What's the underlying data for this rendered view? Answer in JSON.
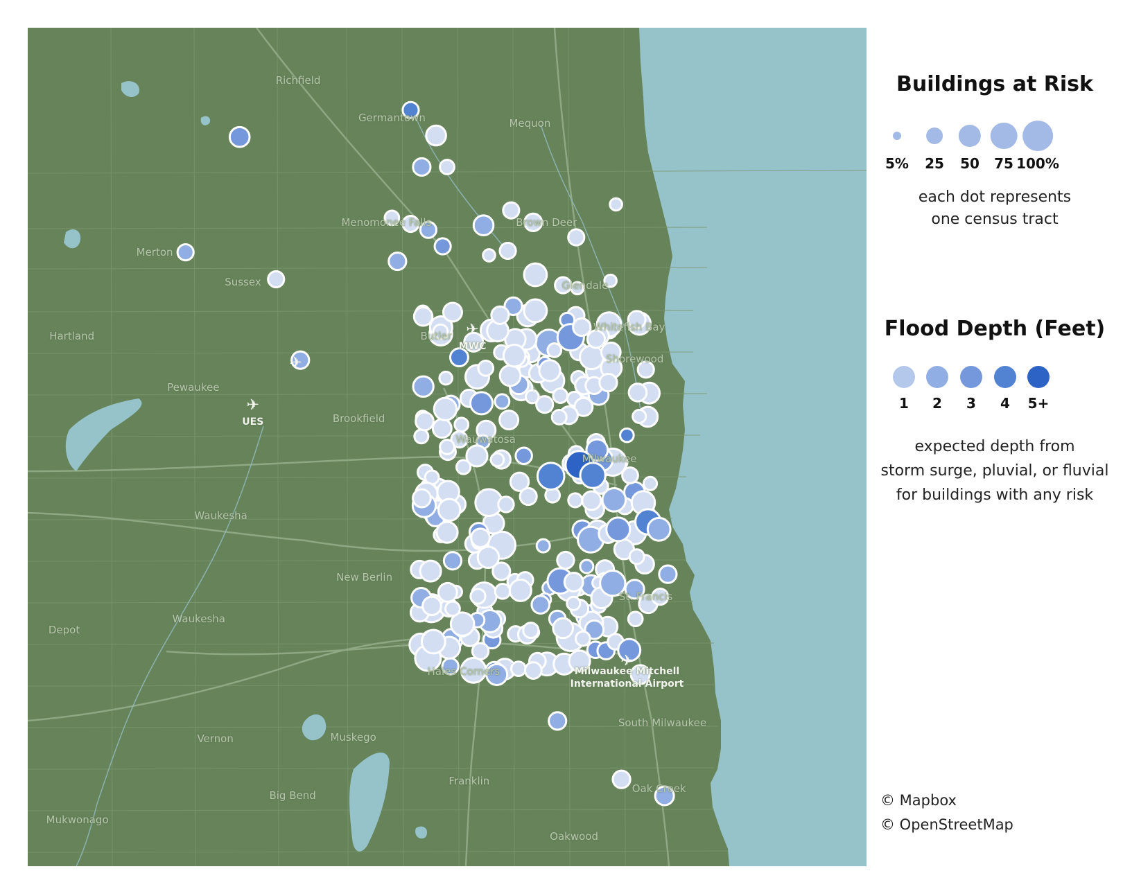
{
  "map": {
    "places": [
      {
        "name": "Richfield",
        "lat": 43.255,
        "lon": -88.195
      },
      {
        "name": "Germantown",
        "lat": 43.23,
        "lon": -88.11
      },
      {
        "name": "Mequon",
        "lat": 43.226,
        "lon": -87.985
      },
      {
        "name": "Menomonee Falls",
        "lat": 43.16,
        "lon": -88.115
      },
      {
        "name": "Brown Deer",
        "lat": 43.16,
        "lon": -87.97
      },
      {
        "name": "Merton",
        "lat": 43.14,
        "lon": -88.325
      },
      {
        "name": "Sussex",
        "lat": 43.12,
        "lon": -88.245
      },
      {
        "name": "Glendale",
        "lat": 43.118,
        "lon": -87.935
      },
      {
        "name": "Whitefish Bay",
        "lat": 43.09,
        "lon": -87.895
      },
      {
        "name": "Butler",
        "lat": 43.084,
        "lon": -88.07
      },
      {
        "name": "Hartland",
        "lat": 43.084,
        "lon": -88.4
      },
      {
        "name": "Shorewood",
        "lat": 43.069,
        "lon": -87.89
      },
      {
        "name": "Pewaukee",
        "lat": 43.05,
        "lon": -88.29
      },
      {
        "name": "Brookfield",
        "lat": 43.029,
        "lon": -88.14
      },
      {
        "name": "Wauwatosa",
        "lat": 43.015,
        "lon": -88.025
      },
      {
        "name": "Milwaukee",
        "lat": 43.002,
        "lon": -87.913
      },
      {
        "name": "Waukesha",
        "lat": 42.964,
        "lon": -88.265
      },
      {
        "name": "New Berlin",
        "lat": 42.923,
        "lon": -88.135
      },
      {
        "name": "St. Francis",
        "lat": 42.91,
        "lon": -87.88
      },
      {
        "name": "Waukesha",
        "lat": 42.895,
        "lon": -88.285
      },
      {
        "name": "Depot",
        "lat": 42.888,
        "lon": -88.407
      },
      {
        "name": "Hales Corners",
        "lat": 42.86,
        "lon": -88.045
      },
      {
        "name": "South Milwaukee",
        "lat": 42.826,
        "lon": -87.865
      },
      {
        "name": "Muskego",
        "lat": 42.816,
        "lon": -88.145
      },
      {
        "name": "Vernon",
        "lat": 42.815,
        "lon": -88.27
      },
      {
        "name": "Franklin",
        "lat": 42.787,
        "lon": -88.04
      },
      {
        "name": "Oak Creek",
        "lat": 42.782,
        "lon": -87.868
      },
      {
        "name": "Big Bend",
        "lat": 42.777,
        "lon": -88.2
      },
      {
        "name": "Mukwonago",
        "lat": 42.761,
        "lon": -88.395
      },
      {
        "name": "Oakwood",
        "lat": 42.75,
        "lon": -87.945
      }
    ],
    "airports": [
      {
        "name": "MWC",
        "lat": 43.088,
        "lon": -88.037
      },
      {
        "name": "UES",
        "lat": 43.038,
        "lon": -88.236
      },
      {
        "name": "Milwaukee Mitchell International Airport",
        "lat": 42.867,
        "lon": -87.897
      },
      {
        "name": "",
        "lat": 43.066,
        "lon": -88.197
      }
    ]
  },
  "legend": {
    "size_title": "Buildings at Risk",
    "size_items": [
      {
        "label": "5%",
        "value": 5
      },
      {
        "label": "25",
        "value": 25
      },
      {
        "label": "50",
        "value": 50
      },
      {
        "label": "75",
        "value": 75
      },
      {
        "label": "100%",
        "value": 100
      }
    ],
    "size_note_1": "each dot represents",
    "size_note_2": "one census tract",
    "color_title": "Flood Depth (Feet)",
    "color_items": [
      {
        "label": "1",
        "color": "#b4c8ec"
      },
      {
        "label": "2",
        "color": "#91aee4"
      },
      {
        "label": "3",
        "color": "#7598dc"
      },
      {
        "label": "4",
        "color": "#5282d2"
      },
      {
        "label": "5+",
        "color": "#2d63c4"
      }
    ],
    "color_note_1": "expected depth from",
    "color_note_2": "storm surge, pluvial, or fluvial",
    "color_note_3": "for buildings with any risk"
  },
  "colors": {
    "land": "#66835a",
    "water": "#96c3ca",
    "road": "#7f9a73",
    "dot_outline": "#ffffff",
    "light_fill": "#d5e0f3"
  },
  "credits": [
    "© Mapbox",
    "© OpenStreetMap"
  ],
  "tracts": [
    {
      "lat": 43.235,
      "lon": -88.093,
      "risk": 15,
      "depth": 4
    },
    {
      "lat": 43.217,
      "lon": -88.248,
      "risk": 30,
      "depth": 3
    },
    {
      "lat": 43.218,
      "lon": -88.07,
      "risk": 30,
      "depth": 1
    },
    {
      "lat": 43.197,
      "lon": -88.083,
      "risk": 20,
      "depth": 2
    },
    {
      "lat": 43.197,
      "lon": -88.06,
      "risk": 10,
      "depth": 1
    },
    {
      "lat": 43.159,
      "lon": -88.093,
      "risk": 15,
      "depth": 1
    },
    {
      "lat": 43.163,
      "lon": -88.11,
      "risk": 10,
      "depth": 1
    },
    {
      "lat": 43.155,
      "lon": -88.077,
      "risk": 15,
      "depth": 2
    },
    {
      "lat": 43.144,
      "lon": -88.064,
      "risk": 15,
      "depth": 3
    },
    {
      "lat": 43.158,
      "lon": -88.027,
      "risk": 30,
      "depth": 2
    },
    {
      "lat": 43.168,
      "lon": -88.002,
      "risk": 15,
      "depth": 1
    },
    {
      "lat": 43.16,
      "lon": -87.982,
      "risk": 20,
      "depth": 1
    },
    {
      "lat": 43.15,
      "lon": -87.943,
      "risk": 15,
      "depth": 1
    },
    {
      "lat": 43.172,
      "lon": -87.907,
      "risk": 5,
      "depth": 1
    },
    {
      "lat": 43.14,
      "lon": -88.297,
      "risk": 15,
      "depth": 2
    },
    {
      "lat": 43.134,
      "lon": -88.105,
      "risk": 20,
      "depth": 2
    },
    {
      "lat": 43.122,
      "lon": -88.215,
      "risk": 15,
      "depth": 1
    },
    {
      "lat": 43.141,
      "lon": -88.005,
      "risk": 15,
      "depth": 1
    },
    {
      "lat": 43.138,
      "lon": -88.022,
      "risk": 5,
      "depth": 1
    },
    {
      "lat": 43.125,
      "lon": -87.98,
      "risk": 45,
      "depth": 1
    },
    {
      "lat": 43.118,
      "lon": -87.955,
      "risk": 15,
      "depth": 1
    },
    {
      "lat": 43.116,
      "lon": -87.942,
      "risk": 5,
      "depth": 1
    },
    {
      "lat": 43.121,
      "lon": -87.912,
      "risk": 5,
      "depth": 1
    },
    {
      "lat": 43.1,
      "lon": -88.055,
      "risk": 25,
      "depth": 1
    },
    {
      "lat": 43.104,
      "lon": -88.0,
      "risk": 20,
      "depth": 2
    },
    {
      "lat": 43.098,
      "lon": -88.012,
      "risk": 20,
      "depth": 1
    },
    {
      "lat": 43.101,
      "lon": -87.98,
      "risk": 45,
      "depth": 1
    },
    {
      "lat": 43.087,
      "lon": -88.066,
      "risk": 10,
      "depth": 1
    },
    {
      "lat": 43.09,
      "lon": -87.938,
      "risk": 20,
      "depth": 1
    },
    {
      "lat": 43.082,
      "lon": -87.925,
      "risk": 20,
      "depth": 1
    },
    {
      "lat": 43.068,
      "lon": -88.193,
      "risk": 20,
      "depth": 2
    },
    {
      "lat": 43.08,
      "lon": -88.036,
      "risk": 25,
      "depth": 1
    },
    {
      "lat": 43.071,
      "lon": -87.999,
      "risk": 40,
      "depth": 1
    },
    {
      "lat": 43.061,
      "lon": -87.967,
      "risk": 35,
      "depth": 1
    },
    {
      "lat": 43.053,
      "lon": -87.914,
      "risk": 20,
      "depth": 1
    },
    {
      "lat": 43.028,
      "lon": -88.004,
      "risk": 25,
      "depth": 1
    },
    {
      "lat": 43.015,
      "lon": -88.049,
      "risk": 15,
      "depth": 1
    },
    {
      "lat": 43.01,
      "lon": -88.06,
      "risk": 10,
      "depth": 1
    },
    {
      "lat": 43.004,
      "lon": -88.033,
      "risk": 35,
      "depth": 1
    },
    {
      "lat": 42.998,
      "lon": -87.94,
      "risk": 80,
      "depth": 5
    },
    {
      "lat": 42.991,
      "lon": -87.928,
      "risk": 60,
      "depth": 4
    },
    {
      "lat": 42.98,
      "lon": -88.059,
      "risk": 40,
      "depth": 1
    },
    {
      "lat": 42.968,
      "lon": -88.058,
      "risk": 40,
      "depth": 1
    },
    {
      "lat": 42.96,
      "lon": -87.878,
      "risk": 60,
      "depth": 4
    },
    {
      "lat": 42.955,
      "lon": -87.868,
      "risk": 45,
      "depth": 2
    },
    {
      "lat": 42.955,
      "lon": -87.905,
      "risk": 50,
      "depth": 3
    },
    {
      "lat": 42.953,
      "lon": -88.06,
      "risk": 35,
      "depth": 1
    },
    {
      "lat": 42.934,
      "lon": -88.055,
      "risk": 20,
      "depth": 2
    },
    {
      "lat": 42.925,
      "lon": -87.86,
      "risk": 20,
      "depth": 2
    },
    {
      "lat": 42.919,
      "lon": -87.91,
      "risk": 60,
      "depth": 2
    },
    {
      "lat": 42.915,
      "lon": -87.89,
      "risk": 25,
      "depth": 2
    },
    {
      "lat": 42.91,
      "lon": -87.867,
      "risk": 15,
      "depth": 1
    },
    {
      "lat": 42.902,
      "lon": -88.055,
      "risk": 10,
      "depth": 1
    },
    {
      "lat": 42.889,
      "lon": -87.955,
      "risk": 30,
      "depth": 1
    },
    {
      "lat": 42.882,
      "lon": -87.937,
      "risk": 10,
      "depth": 1
    },
    {
      "lat": 42.865,
      "lon": -87.954,
      "risk": 35,
      "depth": 1
    },
    {
      "lat": 42.867,
      "lon": -87.94,
      "risk": 35,
      "depth": 1
    },
    {
      "lat": 42.858,
      "lon": -87.885,
      "risk": 25,
      "depth": 1
    },
    {
      "lat": 42.858,
      "lon": -88.015,
      "risk": 35,
      "depth": 2
    },
    {
      "lat": 42.827,
      "lon": -87.96,
      "risk": 20,
      "depth": 2
    },
    {
      "lat": 42.788,
      "lon": -87.902,
      "risk": 20,
      "depth": 1
    },
    {
      "lat": 42.777,
      "lon": -87.863,
      "risk": 25,
      "depth": 2
    }
  ]
}
